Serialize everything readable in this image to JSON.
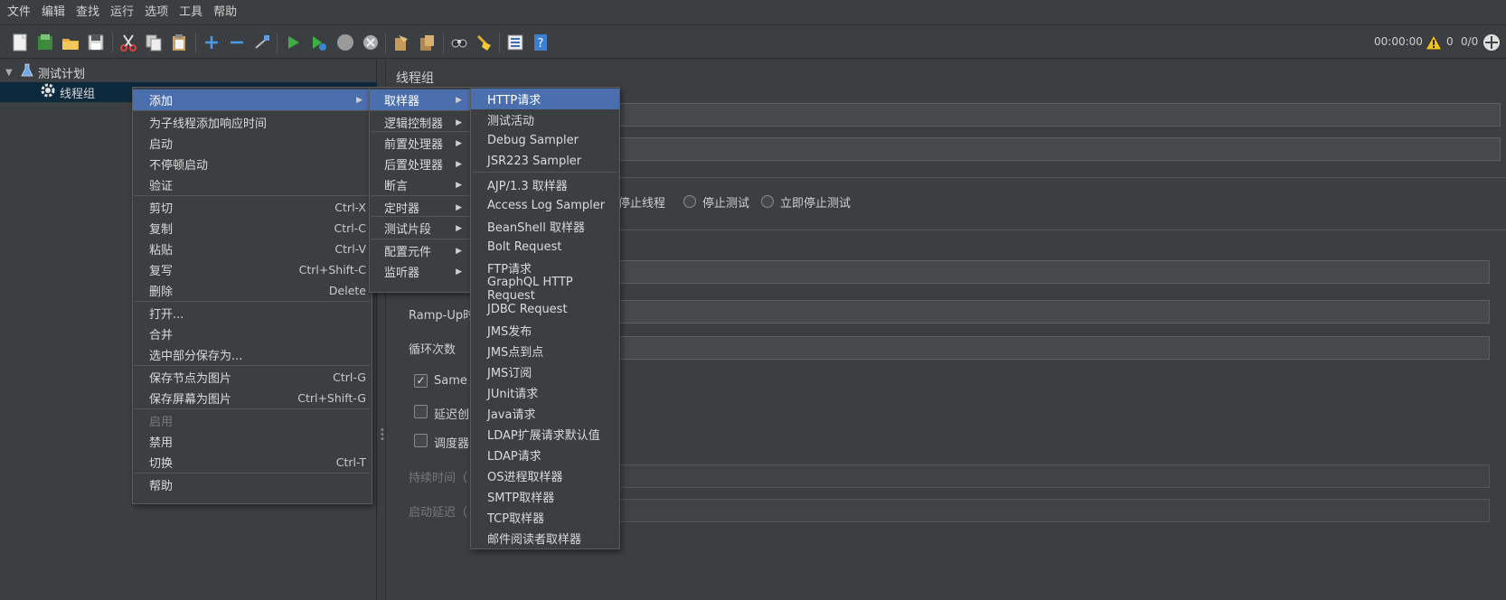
{
  "menubar": [
    "文件",
    "编辑",
    "查找",
    "运行",
    "选项",
    "工具",
    "帮助"
  ],
  "status": {
    "time": "00:00:00",
    "warnings": "0",
    "threads": "0/0"
  },
  "tree": {
    "root": "测试计划",
    "child": "线程组"
  },
  "panel": {
    "title": "线程组",
    "radio_labels": [
      "停止线程",
      "停止测试",
      "立即停止测试"
    ],
    "rampup_label": "Ramp-Up时",
    "loop_label": "循环次数",
    "same_user_label": "Same u",
    "delay_label": "延迟创",
    "scheduler_label": "调度器",
    "duration_label": "持续时间（",
    "startup_delay_label": "启动延迟（"
  },
  "ctx_main": [
    {
      "label": "添加",
      "arrow": "▶"
    },
    {
      "label": "为子线程添加响应时间"
    },
    {
      "label": "启动"
    },
    {
      "label": "不停顿启动"
    },
    {
      "label": "验证"
    },
    {
      "label": "剪切",
      "shortcut": "Ctrl-X"
    },
    {
      "label": "复制",
      "shortcut": "Ctrl-C"
    },
    {
      "label": "粘贴",
      "shortcut": "Ctrl-V"
    },
    {
      "label": "复写",
      "shortcut": "Ctrl+Shift-C"
    },
    {
      "label": "删除",
      "shortcut": "Delete"
    },
    {
      "label": "打开..."
    },
    {
      "label": "合并"
    },
    {
      "label": "选中部分保存为..."
    },
    {
      "label": "保存节点为图片",
      "shortcut": "Ctrl-G"
    },
    {
      "label": "保存屏幕为图片",
      "shortcut": "Ctrl+Shift-G"
    },
    {
      "label": "启用"
    },
    {
      "label": "禁用"
    },
    {
      "label": "切换",
      "shortcut": "Ctrl-T"
    },
    {
      "label": "帮助"
    }
  ],
  "ctx_add": [
    {
      "label": "取样器",
      "arrow": "▶"
    },
    {
      "label": "逻辑控制器",
      "arrow": "▶"
    },
    {
      "label": "前置处理器",
      "arrow": "▶"
    },
    {
      "label": "后置处理器",
      "arrow": "▶"
    },
    {
      "label": "断言",
      "arrow": "▶"
    },
    {
      "label": "定时器",
      "arrow": "▶"
    },
    {
      "label": "测试片段",
      "arrow": "▶"
    },
    {
      "label": "配置元件",
      "arrow": "▶"
    },
    {
      "label": "监听器",
      "arrow": "▶"
    }
  ],
  "ctx_samplers": [
    "HTTP请求",
    "测试活动",
    "Debug Sampler",
    "JSR223 Sampler",
    "AJP/1.3 取样器",
    "Access Log Sampler",
    "BeanShell 取样器",
    "Bolt Request",
    "FTP请求",
    "GraphQL HTTP Request",
    "JDBC Request",
    "JMS发布",
    "JMS点到点",
    "JMS订阅",
    "JUnit请求",
    "Java请求",
    "LDAP扩展请求默认值",
    "LDAP请求",
    "OS进程取样器",
    "SMTP取样器",
    "TCP取样器",
    "邮件阅读者取样器"
  ],
  "colors": {
    "highlight": "#4b6eaf",
    "background": "#3c3f41"
  }
}
